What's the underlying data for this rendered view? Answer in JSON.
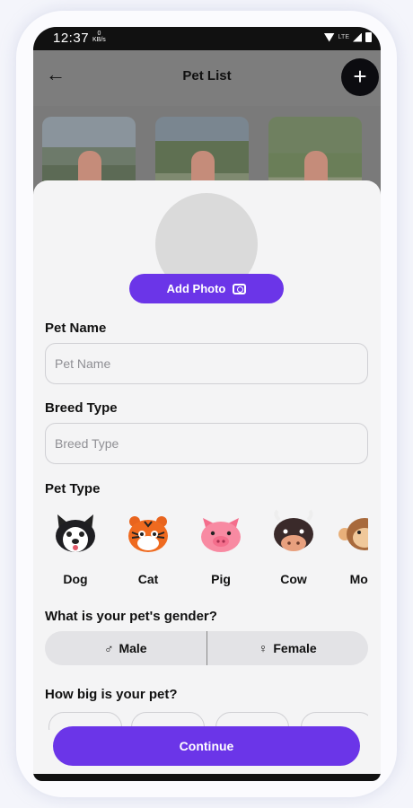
{
  "status_bar": {
    "time": "12:37",
    "net_speed": "0",
    "net_unit": "KB/s",
    "lte": "LTE"
  },
  "app_bar": {
    "title": "Pet List"
  },
  "form": {
    "add_photo_label": "Add Photo",
    "pet_name": {
      "label": "Pet Name",
      "placeholder": "Pet Name"
    },
    "breed_type": {
      "label": "Breed Type",
      "placeholder": "Breed Type"
    },
    "pet_type": {
      "label": "Pet Type",
      "options": [
        {
          "name": "Dog",
          "icon": "husky-dog-icon"
        },
        {
          "name": "Cat",
          "icon": "tiger-cat-icon"
        },
        {
          "name": "Pig",
          "icon": "pig-icon"
        },
        {
          "name": "Cow",
          "icon": "cow-icon"
        },
        {
          "name": "Mon",
          "icon": "monkey-icon"
        }
      ]
    },
    "gender": {
      "question": "What is your pet's gender?",
      "male_symbol": "♂",
      "male": "Male",
      "female_symbol": "♀",
      "female": "Female"
    },
    "size": {
      "question": "How big is your pet?"
    },
    "continue_label": "Continue"
  },
  "colors": {
    "accent": "#6b35e8",
    "overlay": "#7a7a7a",
    "sheet": "#f4f4f5"
  }
}
